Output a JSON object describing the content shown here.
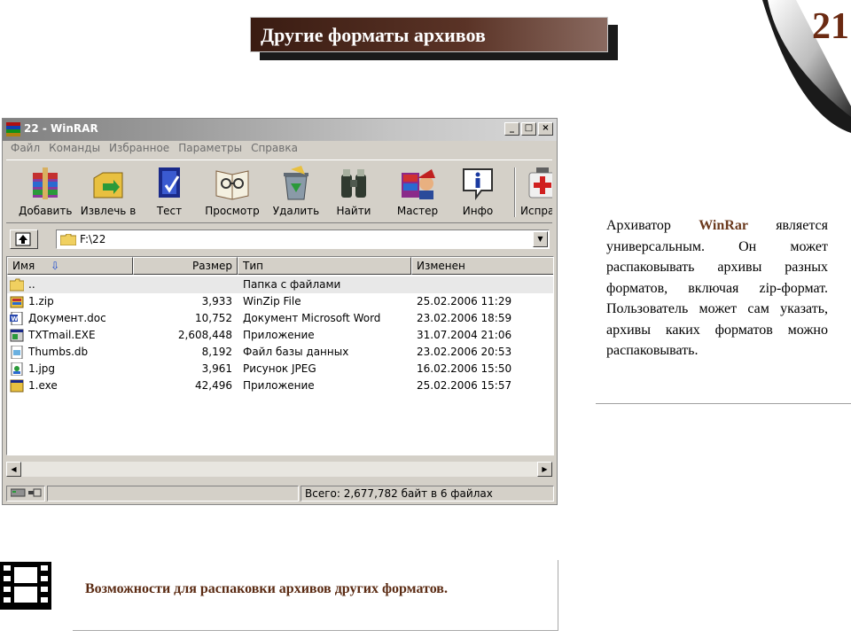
{
  "slide": {
    "title": "Другие форматы архивов",
    "page_number": "21"
  },
  "window": {
    "title": "22 - WinRAR",
    "controls": [
      "_",
      "□",
      "×"
    ],
    "menu": [
      "Файл",
      "Команды",
      "Избранное",
      "Параметры",
      "Справка"
    ],
    "toolbar": [
      {
        "label": "Добавить",
        "icon": "add-archive-icon"
      },
      {
        "label": "Извлечь в",
        "icon": "extract-icon"
      },
      {
        "label": "Тест",
        "icon": "test-icon"
      },
      {
        "label": "Просмотр",
        "icon": "view-icon"
      },
      {
        "label": "Удалить",
        "icon": "delete-icon"
      },
      {
        "label": "Найти",
        "icon": "find-icon"
      },
      {
        "label": "Мастер",
        "icon": "wizard-icon"
      },
      {
        "label": "Инфо",
        "icon": "info-icon"
      },
      {
        "label": "Испра",
        "icon": "repair-icon"
      }
    ],
    "address": "F:\\22",
    "columns": [
      "Имя",
      "Размер",
      "Тип",
      "Изменен"
    ],
    "files": [
      {
        "name": "..",
        "size": "",
        "type": "Папка с файлами",
        "modified": "",
        "icon": "folder-icon"
      },
      {
        "name": "1.zip",
        "size": "3,933",
        "type": "WinZip File",
        "modified": "25.02.2006 11:29",
        "icon": "zip-icon"
      },
      {
        "name": "Документ.doc",
        "size": "10,752",
        "type": "Документ Microsoft Word",
        "modified": "23.02.2006 18:59",
        "icon": "word-doc-icon"
      },
      {
        "name": "TXTmail.EXE",
        "size": "2,608,448",
        "type": "Приложение",
        "modified": "31.07.2004 21:06",
        "icon": "exe-icon"
      },
      {
        "name": "Thumbs.db",
        "size": "8,192",
        "type": "Файл базы данных",
        "modified": "23.02.2006 20:53",
        "icon": "db-icon"
      },
      {
        "name": "1.jpg",
        "size": "3,961",
        "type": "Рисунок JPEG",
        "modified": "16.02.2006 15:50",
        "icon": "image-icon"
      },
      {
        "name": "1.exe",
        "size": "42,496",
        "type": "Приложение",
        "modified": "25.02.2006 15:57",
        "icon": "exe-icon"
      }
    ],
    "status": "Всего: 2,677,782 байт в 6 файлах"
  },
  "description": {
    "prefix": "Архиватор ",
    "highlight": "WinRar",
    "rest": " является универсальным. Он может распаковывать архивы разных форматов, включая zip-формат. Пользователь может сам указать, архивы каких форматов можно распаковывать."
  },
  "caption": "Возможности для  распаковки архивов других форматов.",
  "colors": {
    "title_bg": "#3a1c12",
    "accent_text": "#6b3a1e",
    "caption_text": "#5a2a12"
  }
}
